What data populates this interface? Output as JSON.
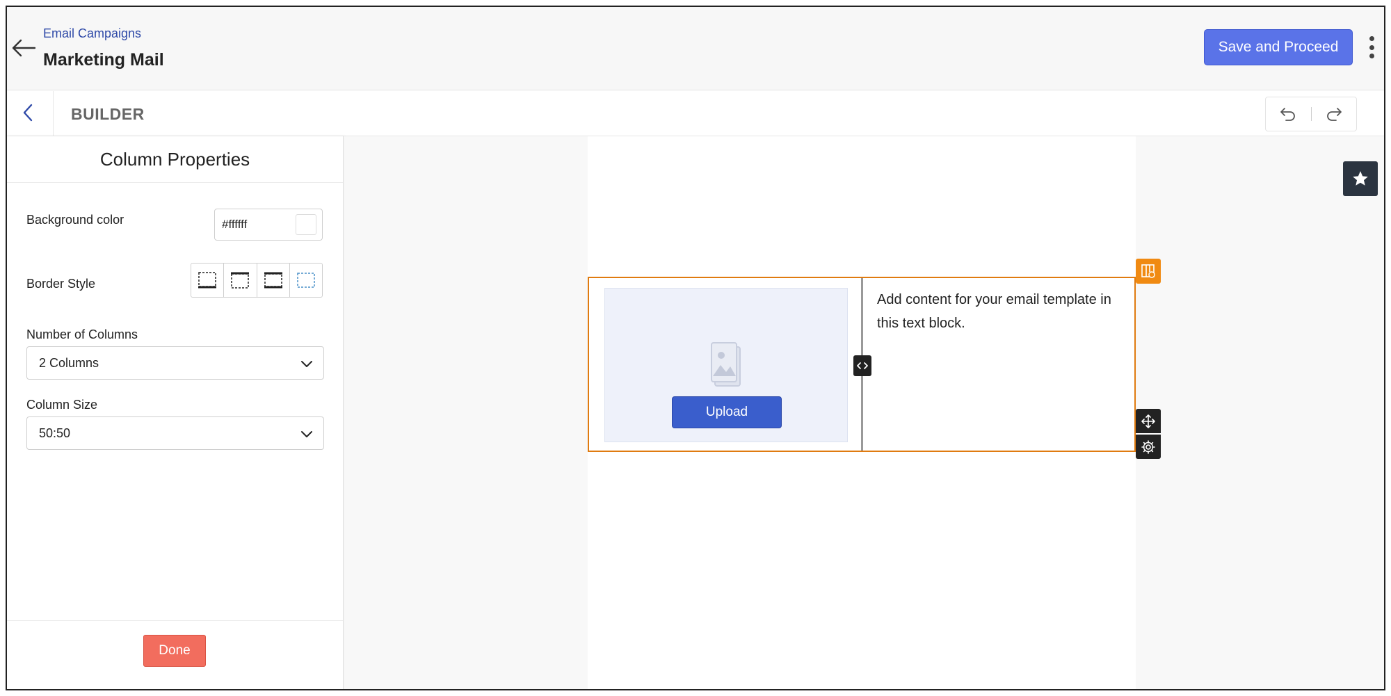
{
  "header": {
    "breadcrumb": "Email Campaigns",
    "title": "Marketing Mail",
    "save_label": "Save and Proceed",
    "back_icon": "arrow-left-icon",
    "more_icon": "kebab-menu-icon"
  },
  "builder_bar": {
    "label": "BUILDER",
    "back_icon": "chevron-left-icon",
    "undo_icon": "undo-icon",
    "redo_icon": "redo-icon"
  },
  "panel": {
    "title": "Column Properties",
    "background_color": {
      "label": "Background color",
      "value": "#ffffff"
    },
    "border_style": {
      "label": "Border Style",
      "options": [
        "border-bottom-icon",
        "border-top-icon",
        "border-top-bottom-icon",
        "border-none-icon"
      ]
    },
    "columns": {
      "label": "Number of Columns",
      "selected": "2 Columns"
    },
    "column_size": {
      "label": "Column Size",
      "selected": "50:50"
    },
    "done_label": "Done"
  },
  "canvas": {
    "upload_label": "Upload",
    "text_block": "Add content for your email template in this text block.",
    "row_badge_icon": "column-settings-icon",
    "move_icon": "move-icon",
    "settings_icon": "gear-icon",
    "resize_icon": "resize-handle-icon",
    "favorite_icon": "star-icon"
  },
  "colors": {
    "primary_button": "#5a73e8",
    "upload_button": "#3a5ecc",
    "done_button": "#f26d5e",
    "selection_border": "#e07b10",
    "breadcrumb": "#2f4aa8"
  }
}
